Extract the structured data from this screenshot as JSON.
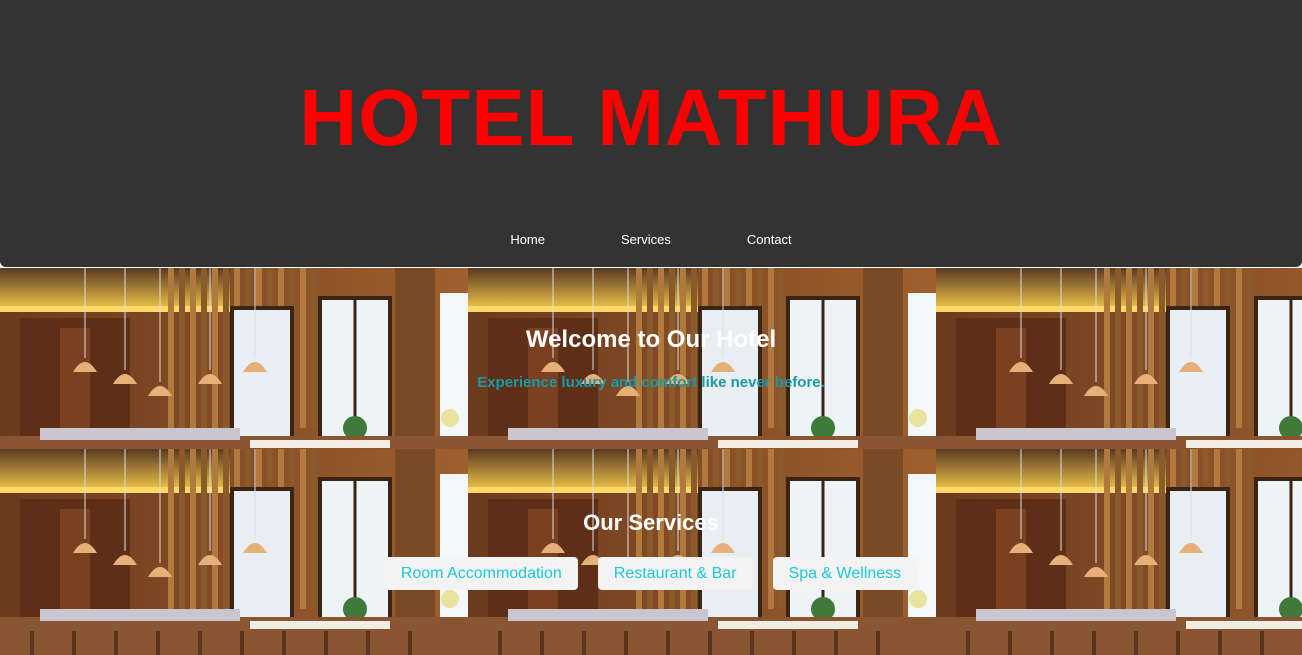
{
  "header": {
    "title": "HOTEL MATHURA",
    "nav": [
      "Home",
      "Services",
      "Contact"
    ]
  },
  "hero": {
    "heading": "Welcome to Our Hotel",
    "tagline": "Experience luxury and comfort like never before."
  },
  "services": {
    "heading": "Our Services",
    "items": [
      "Room Accommodation",
      "Restaurant & Bar",
      "Spa & Wellness"
    ]
  },
  "colors": {
    "header_bg": "#333333",
    "title": "#ff0000",
    "tagline": "#1a9aa6",
    "service_text": "#1ec8d8",
    "service_bg": "#f3f3f3"
  },
  "background_image": "restaurant-interior-photo"
}
